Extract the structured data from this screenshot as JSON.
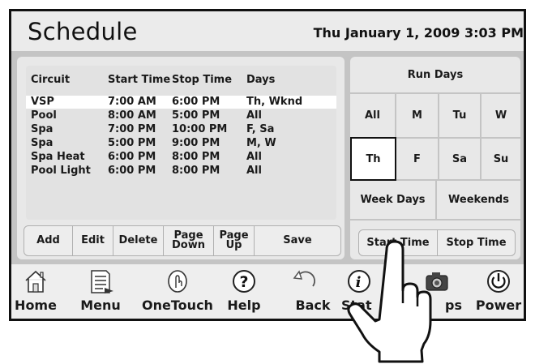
{
  "header": {
    "title": "Schedule",
    "datetime": "Thu January 1, 2009  3:03 PM"
  },
  "table": {
    "headers": [
      "Circuit",
      "Start Time",
      "Stop Time",
      "Days"
    ],
    "rows": [
      {
        "circuit": "VSP",
        "start": "7:00 AM",
        "stop": "6:00 PM",
        "days": "Th, Wknd"
      },
      {
        "circuit": "Pool",
        "start": "8:00 AM",
        "stop": "5:00 PM",
        "days": "All"
      },
      {
        "circuit": "Spa",
        "start": "7:00 PM",
        "stop": "10:00 PM",
        "days": "F, Sa"
      },
      {
        "circuit": "Spa",
        "start": "5:00 PM",
        "stop": "9:00 PM",
        "days": "M, W"
      },
      {
        "circuit": "Spa Heat",
        "start": "6:00 PM",
        "stop": "8:00 PM",
        "days": "All"
      },
      {
        "circuit": "Pool Light",
        "start": "6:00 PM",
        "stop": "8:00 PM",
        "days": "All"
      }
    ]
  },
  "actions": {
    "add": "Add",
    "edit": "Edit",
    "delete": "Delete",
    "page_down_1": "Page",
    "page_down_2": "Down",
    "page_up_1": "Page",
    "page_up_2": "Up",
    "save": "Save"
  },
  "run_days": {
    "title": "Run Days",
    "all": "All",
    "mon": "M",
    "tue": "Tu",
    "wed": "W",
    "thu": "Th",
    "fri": "F",
    "sat": "Sa",
    "sun": "Su",
    "week_days": "Week Days",
    "weekends": "Weekends"
  },
  "time_buttons": {
    "start": "Start Time",
    "stop": "Stop Time"
  },
  "nav": {
    "home": "Home",
    "menu": "Menu",
    "onetouch": "OneTouch",
    "help": "Help",
    "back": "Back",
    "status_visible": "Stat",
    "snapshots_visible": "ps",
    "power": "Power"
  }
}
